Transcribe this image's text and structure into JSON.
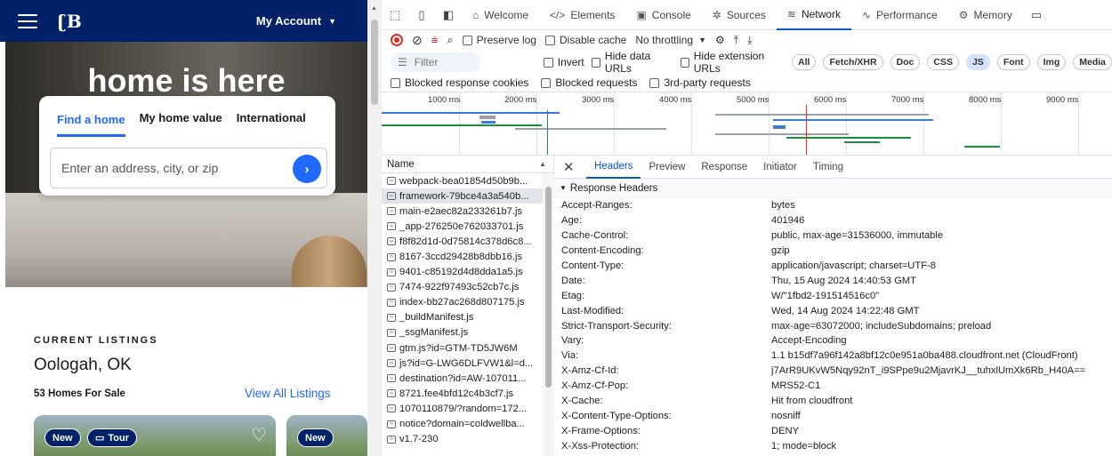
{
  "site": {
    "account_label": "My Account",
    "hero_title": "home is here",
    "search_tabs": [
      "Find a home",
      "My home value",
      "International"
    ],
    "search_placeholder": "Enter an address, city, or zip",
    "listings_label": "CURRENT LISTINGS",
    "city": "Oologah, OK",
    "homes_count": "53 Homes For Sale",
    "view_all": "View All Listings",
    "card1_badges": [
      "New",
      "Tour"
    ],
    "card2_badge": "New"
  },
  "devtools": {
    "tabs": [
      "Welcome",
      "Elements",
      "Console",
      "Sources",
      "Network",
      "Performance",
      "Memory"
    ],
    "active_tab": "Network",
    "toolbar": {
      "preserve_log": "Preserve log",
      "disable_cache": "Disable cache",
      "throttling": "No throttling"
    },
    "filter": {
      "placeholder": "Filter",
      "invert": "Invert",
      "hide_data_urls": "Hide data URLs",
      "hide_extension_urls": "Hide extension URLs",
      "chips": [
        "All",
        "Fetch/XHR",
        "Doc",
        "CSS",
        "JS",
        "Font",
        "Img",
        "Media"
      ],
      "active_chip": "JS"
    },
    "blocks": [
      "Blocked response cookies",
      "Blocked requests",
      "3rd-party requests"
    ],
    "timeline_ticks": [
      "1000 ms",
      "2000 ms",
      "3000 ms",
      "4000 ms",
      "5000 ms",
      "6000 ms",
      "7000 ms",
      "8000 ms",
      "9000 ms"
    ],
    "name_header": "Name",
    "requests": [
      "webpack-bea01854d50b9b...",
      "framework-79bce4a3a540b...",
      "main-e2aec82a233261b7.js",
      "_app-276250e762033701.js",
      "f8f82d1d-0d75814c378d6c8...",
      "8167-3ccd29428b8dbb16.js",
      "9401-c85192d4d8dda1a5.js",
      "7474-922f97493c52cb7c.js",
      "index-bb27ac268d807175.js",
      "_buildManifest.js",
      "_ssgManifest.js",
      "gtm.js?id=GTM-TD5JW6M",
      "js?id=G-LWG6DLFVW1&l=d...",
      "destination?id=AW-107011...",
      "8721.fee4bfd12c4b3cf7.js",
      "1070110879/?random=172...",
      "notice?domain=coldwellba...",
      "v1.7-230"
    ],
    "selected_request_index": 1,
    "detail_tabs": [
      "Headers",
      "Preview",
      "Response",
      "Initiator",
      "Timing"
    ],
    "active_detail_tab": "Headers",
    "section_title": "Response Headers",
    "headers": [
      [
        "Accept-Ranges:",
        "bytes"
      ],
      [
        "Age:",
        "401946"
      ],
      [
        "Cache-Control:",
        "public, max-age=31536000, immutable"
      ],
      [
        "Content-Encoding:",
        "gzip"
      ],
      [
        "Content-Type:",
        "application/javascript; charset=UTF-8"
      ],
      [
        "Date:",
        "Thu, 15 Aug 2024 14:40:53 GMT"
      ],
      [
        "Etag:",
        "W/\"1fbd2-191514516c0\""
      ],
      [
        "Last-Modified:",
        "Wed, 14 Aug 2024 14:22:48 GMT"
      ],
      [
        "Strict-Transport-Security:",
        "max-age=63072000; includeSubdomains; preload"
      ],
      [
        "Vary:",
        "Accept-Encoding"
      ],
      [
        "Via:",
        "1.1 b15df7a96f142a8bf12c0e951a0ba488.cloudfront.net (CloudFront)"
      ],
      [
        "X-Amz-Cf-Id:",
        "j7ArR9UKvW5Nqy92nT_i9SPpe9u2MjavrKJ__tuhxlUmXk6Rb_H40A=="
      ],
      [
        "X-Amz-Cf-Pop:",
        "MRS52-C1"
      ],
      [
        "X-Cache:",
        "Hit from cloudfront"
      ],
      [
        "X-Content-Type-Options:",
        "nosniff"
      ],
      [
        "X-Frame-Options:",
        "DENY"
      ],
      [
        "X-Xss-Protection:",
        "1; mode=block"
      ]
    ]
  },
  "colors": {
    "brand_navy": "#012169",
    "link_blue": "#1f69ff",
    "devtools_accent": "#0b57d0"
  }
}
